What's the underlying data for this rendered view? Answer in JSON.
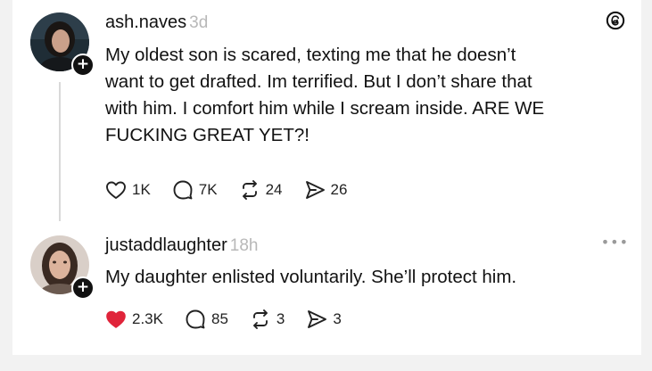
{
  "post": {
    "username": "ash.naves",
    "time": "3d",
    "lines": [
      "My oldest son is scared, texting me that he doesn’t",
      "want to get drafted. Im terrified. But I don’t share that",
      "with him. I comfort him while I scream inside. ARE WE",
      "FUCKING GREAT YET?!"
    ],
    "likes": "1K",
    "replies": "7K",
    "reposts": "24",
    "shares": "26"
  },
  "reply": {
    "username": "justaddlaughter",
    "time": "18h",
    "text": "My daughter enlisted voluntarily. She’ll protect him.",
    "likes": "2.3K",
    "replies": "85",
    "reposts": "3",
    "shares": "3"
  },
  "colors": {
    "liked_heart": "#e0243a",
    "muted_time": "#b8b8b8"
  },
  "icons": [
    "threads-logo-icon",
    "heart-icon",
    "comment-icon",
    "repost-icon",
    "share-icon",
    "more-icon",
    "plus-icon"
  ]
}
